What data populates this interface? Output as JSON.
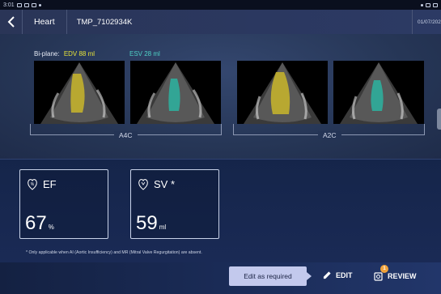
{
  "status_bar": {
    "time": "3:01"
  },
  "header": {
    "title": "Heart",
    "patient_id": "TMP_7102934K",
    "date": "01/07/202"
  },
  "measurements": {
    "prefix": "Bi-plane:",
    "edv": "EDV 88 ml",
    "esv": "ESV 28 ml"
  },
  "views": [
    {
      "label": "A4C"
    },
    {
      "label": "A2C"
    }
  ],
  "metrics": [
    {
      "label": "EF",
      "value": "67",
      "unit": "%"
    },
    {
      "label": "SV *",
      "value": "59",
      "unit": "ml"
    }
  ],
  "footnote": "* Only applicable when AI (Aortic Insufficiency) and MR (Mitral Valve Regurgitation) are absent.",
  "bottom_bar": {
    "tooltip": "Edit as required",
    "edit_label": "EDIT",
    "review_label": "REVIEW",
    "review_badge": "1"
  },
  "colors": {
    "edv": "#e6e23a",
    "esv": "#4fd1c5",
    "tooltip_bg": "#c3c9ed",
    "badge": "#f0a23b"
  }
}
